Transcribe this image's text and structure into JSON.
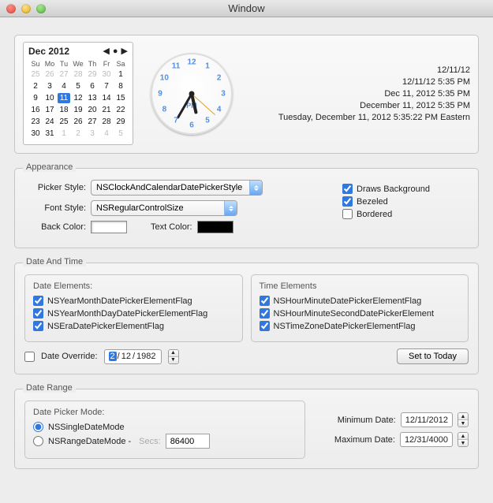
{
  "window": {
    "title": "Window"
  },
  "preview": {
    "cal": {
      "title": "Dec 2012",
      "weekdays": [
        "Su",
        "Mo",
        "Tu",
        "We",
        "Th",
        "Fr",
        "Sa"
      ],
      "lead_off": [
        25,
        26,
        27,
        28,
        29,
        30
      ],
      "days": [
        1,
        2,
        3,
        4,
        5,
        6,
        7,
        8,
        9,
        10,
        11,
        12,
        13,
        14,
        15,
        16,
        17,
        18,
        19,
        20,
        21,
        22,
        23,
        24,
        25,
        26,
        27,
        28,
        29,
        30,
        31
      ],
      "trail_off": [
        1,
        2,
        3,
        4,
        5
      ],
      "selected": 11
    },
    "clock": {
      "ampm": "PM",
      "hour_angle": 167,
      "minute_angle": 210,
      "second_angle": 132
    },
    "dates": {
      "d1": "12/11/12",
      "d2": "12/11/12 5:35 PM",
      "d3": "Dec 11, 2012 5:35 PM",
      "d4": "December 11, 2012 5:35 PM",
      "d5": "Tuesday, December 11, 2012 5:35:22 PM Eastern"
    }
  },
  "appearance": {
    "legend": "Appearance",
    "picker_style_label": "Picker Style:",
    "picker_style": "NSClockAndCalendarDatePickerStyle",
    "font_style_label": "Font Style:",
    "font_style": "NSRegularControlSize",
    "back_color_label": "Back Color:",
    "text_color_label": "Text Color:",
    "back_color": "#ffffff",
    "text_color": "#000000",
    "draws_background": "Draws Background",
    "bezeled": "Bezeled",
    "bordered": "Bordered",
    "draws_background_checked": true,
    "bezeled_checked": true,
    "bordered_checked": false
  },
  "date_time": {
    "legend": "Date And Time",
    "date_elements": {
      "title": "Date Elements:",
      "items": [
        {
          "label": "NSYearMonthDatePickerElementFlag",
          "checked": true
        },
        {
          "label": "NSYearMonthDayDatePickerElementFlag",
          "checked": true
        },
        {
          "label": "NSEraDatePickerElementFlag",
          "checked": true
        }
      ]
    },
    "time_elements": {
      "title": "Time Elements",
      "items": [
        {
          "label": "NSHourMinuteDatePickerElementFlag",
          "checked": true
        },
        {
          "label": "NSHourMinuteSecondDatePickerElement",
          "checked": true
        },
        {
          "label": "NSTimeZoneDatePickerElementFlag",
          "checked": true
        }
      ]
    },
    "override": {
      "label": "Date Override:",
      "checked": false,
      "month": "2",
      "day": "12",
      "year": "1982",
      "set_today": "Set to Today"
    }
  },
  "date_range": {
    "legend": "Date Range",
    "mode_title": "Date Picker Mode:",
    "single_label": "NSSingleDateMode",
    "range_label": "NSRangeDateMode -",
    "secs_label": "Secs:",
    "secs_value": "86400",
    "selected": "single",
    "min_label": "Minimum Date:",
    "max_label": "Maximum Date:",
    "min_value": "12/11/2012",
    "max_value": "12/31/4000"
  }
}
